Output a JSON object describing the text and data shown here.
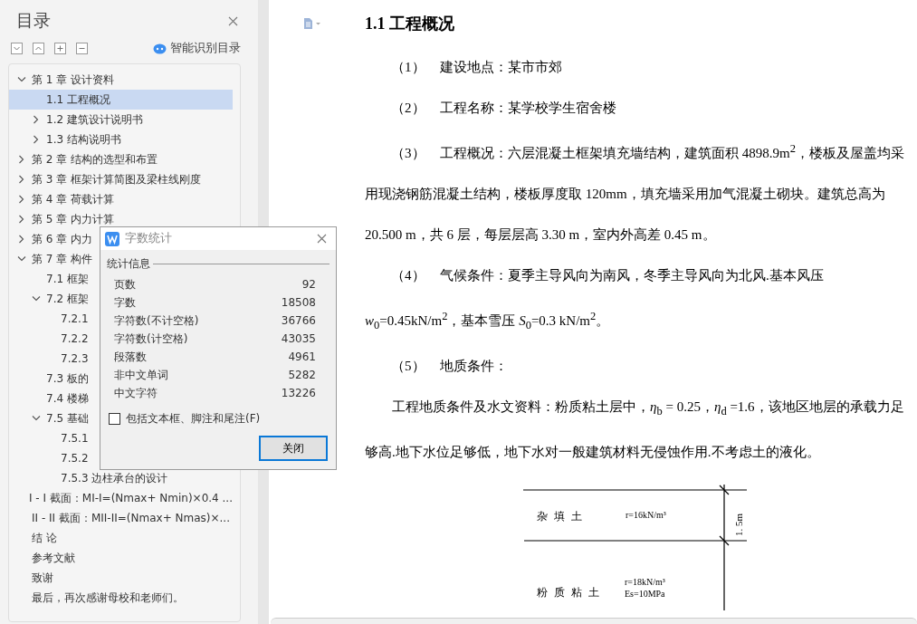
{
  "toc_panel": {
    "title": "目录",
    "smart_toc_label": "智能识别目录",
    "items": [
      {
        "label": "第 1 章  设计资料",
        "expanded": true,
        "selected": false,
        "children": [
          {
            "label": "1.1  工程概况",
            "selected": true
          },
          {
            "label": "1.2  建筑设计说明书",
            "expanded": false,
            "selected": false
          },
          {
            "label": "1.3  结构说明书",
            "expanded": false,
            "selected": false
          }
        ]
      },
      {
        "label": "第 2 章  结构的选型和布置",
        "expanded": false,
        "selected": false
      },
      {
        "label": "第 3 章  框架计算简图及梁柱线刚度",
        "expanded": false,
        "selected": false
      },
      {
        "label": "第 4 章  荷载计算",
        "expanded": false,
        "selected": false
      },
      {
        "label": "第 5 章  内力计算",
        "expanded": false,
        "selected": false
      },
      {
        "label": "第 6 章  内力",
        "expanded": false,
        "selected": false
      },
      {
        "label": "第 7 章  构件",
        "expanded": true,
        "selected": false,
        "children": [
          {
            "label": "7.1  框架",
            "selected": false
          },
          {
            "label": "7.2  框架",
            "expanded": true,
            "selected": false,
            "children": [
              {
                "label": "7.2.1",
                "selected": false
              },
              {
                "label": "7.2.2",
                "selected": false
              },
              {
                "label": "7.2.3",
                "selected": false
              }
            ]
          },
          {
            "label": "7.3  板的",
            "selected": false
          },
          {
            "label": "7.4  楼梯",
            "selected": false
          },
          {
            "label": "7.5  基础",
            "expanded": true,
            "selected": false,
            "children": [
              {
                "label": "7.5.1",
                "selected": false
              },
              {
                "label": "7.5.2",
                "selected": false
              },
              {
                "label": "7.5.3  边柱承台的设计",
                "selected": false
              }
            ]
          }
        ]
      },
      {
        "label": "I - I 截面：MI-I=(Nmax+ Nmin)×0.4 ...",
        "selected": false
      },
      {
        "label": "II - II 截面：MII-II=(Nmax+ Nmas)×...",
        "selected": false
      },
      {
        "label": "结    论",
        "selected": false
      },
      {
        "label": "参考文献",
        "selected": false
      },
      {
        "label": "致谢",
        "selected": false
      },
      {
        "label": "最后，再次感谢母校和老师们。",
        "selected": false
      }
    ]
  },
  "dialog": {
    "title": "字数统计",
    "group_label": "统计信息",
    "stats": [
      {
        "label": "页数",
        "value": "92"
      },
      {
        "label": "字数",
        "value": "18508"
      },
      {
        "label": "字符数(不计空格)",
        "value": "36766"
      },
      {
        "label": "字符数(计空格)",
        "value": "43035"
      },
      {
        "label": "段落数",
        "value": "4961"
      },
      {
        "label": "非中文单词",
        "value": "5282"
      },
      {
        "label": "中文字符",
        "value": "13226"
      }
    ],
    "checkbox": {
      "label": "包括文本框、脚注和尾注(F)",
      "checked": false
    },
    "button": "关闭"
  },
  "document": {
    "blocks": [
      {
        "kind": "heading",
        "text": "1.1  工程概况"
      },
      {
        "kind": "numbered",
        "number": "（1）",
        "text": "建设地点：某市市郊"
      },
      {
        "kind": "numbered",
        "number": "（2）",
        "text": "工程名称：某学校学生宿舍楼"
      },
      {
        "kind": "numbered",
        "number": "（3）",
        "text": "工程概况：六层混凝土框架填充墙结构，建筑面积 4898.9m$^{2}$，楼板及屋盖均采用现浇钢筋混凝土结构，楼板厚度取 120mm，填充墙采用加气混凝土砌块。建筑总高为 20.500 m，共 6 层，每层层高 3.30 m，室内外高差 0.45 m。"
      },
      {
        "kind": "numbered",
        "number": "（4）",
        "text": "气候条件：夏季主导风向为南风，冬季主导风向为北风.基本风压 *w*$_{0}$=0.45kN/m$^{2}$，基本雪压 *S*$_{0}$=0.3 kN/m$^{2}$。"
      },
      {
        "kind": "numbered",
        "number": "（5）",
        "text": "地质条件："
      },
      {
        "kind": "paragraph",
        "text": "工程地质条件及水文资料：粉质粘土层中，*η*$_{b}$ = 0.25，*η*$_{d}$ =1.6，该地区地层的承载力足够高.地下水位足够低，地下水对一般建筑材料无侵蚀作用.不考虑土的液化。"
      }
    ],
    "figure": {
      "layers": [
        {
          "name": "杂 填 土",
          "props": [
            "r=16kN/m³"
          ],
          "thickness": "1. 5m"
        },
        {
          "name": "粉 质 粘 土",
          "props": [
            "r=18kN/m³",
            "Es=10MPa"
          ]
        }
      ]
    }
  }
}
